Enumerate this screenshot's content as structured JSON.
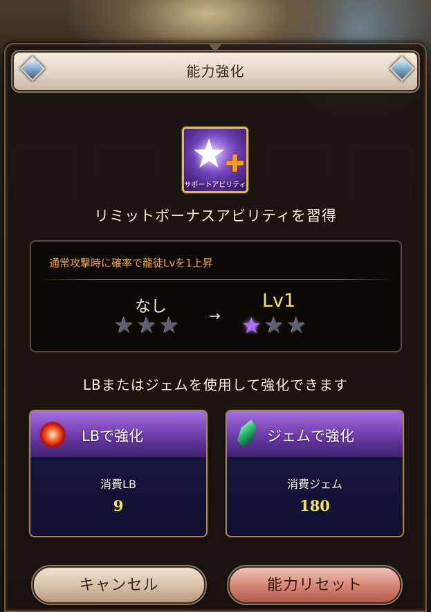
{
  "dialog": {
    "title": "能力強化"
  },
  "ability": {
    "icon_name": "support-ability-star-icon",
    "caption": "サポートアビリティ",
    "acquire_text": "リミットボーナスアビリティを習得",
    "description": "通常攻撃時に確率で龍徒Lvを1上昇",
    "level_from": "なし",
    "level_to": "Lv1",
    "arrow": "→",
    "stars_from": [
      false,
      false,
      false
    ],
    "stars_to": [
      true,
      false,
      false
    ]
  },
  "hint": "LBまたはジェムを使用して強化できます",
  "cards": {
    "lb": {
      "icon_name": "lb-orb-icon",
      "label": "LBで強化",
      "cost_label": "消費LB",
      "cost_value": "9"
    },
    "gem": {
      "icon_name": "gem-crystal-icon",
      "label": "ジェムで強化",
      "cost_label": "消費ジェム",
      "cost_value": "180"
    }
  },
  "buttons": {
    "cancel": "キャンセル",
    "reset": "能力リセット"
  },
  "colors": {
    "accent_orange": "#f0a83c",
    "level_yellow": "#f5e64a",
    "card_purple": "#6c3aa8"
  }
}
